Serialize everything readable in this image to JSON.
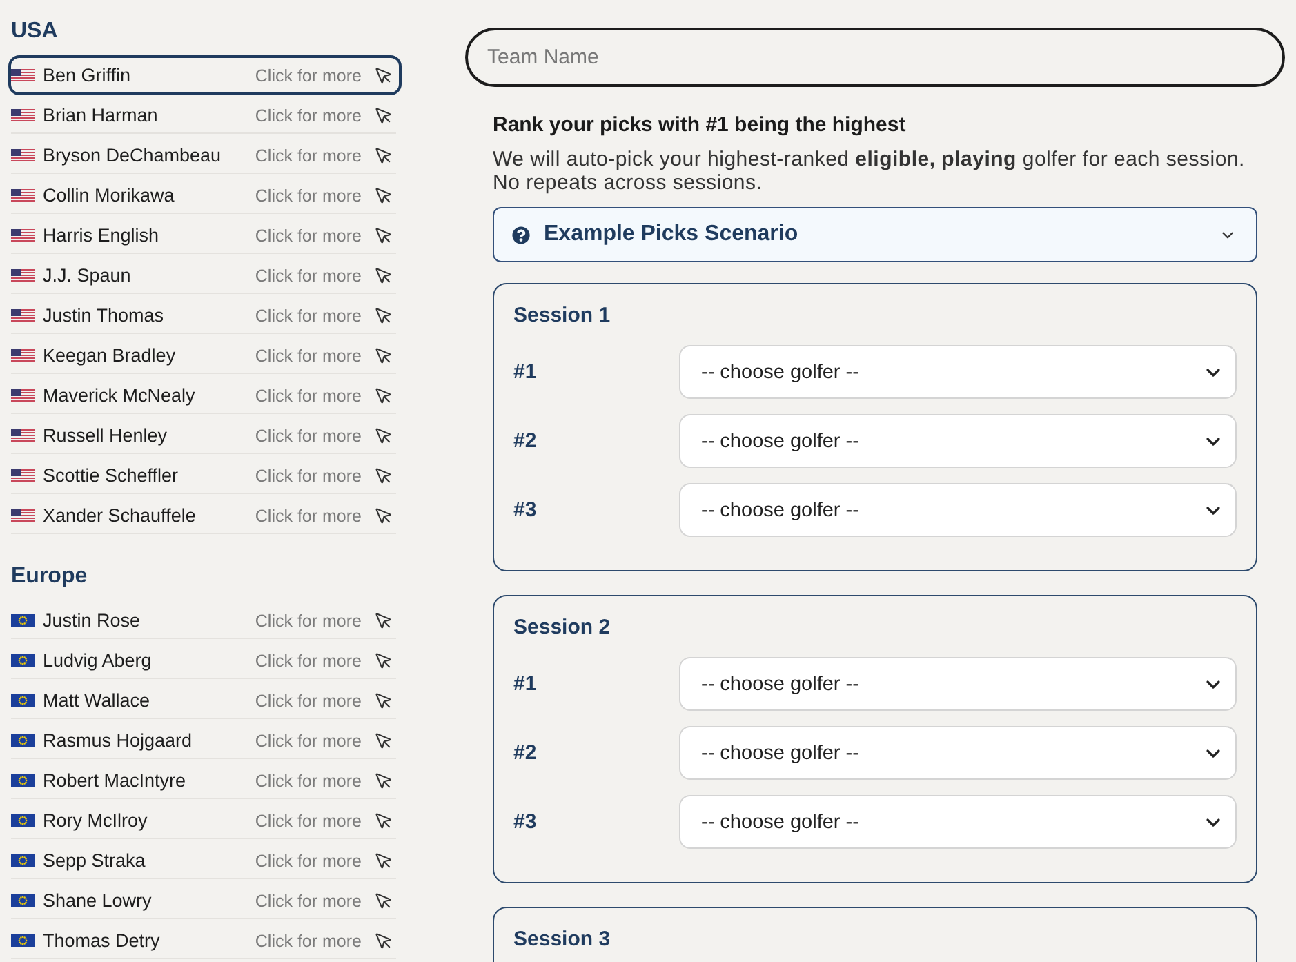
{
  "sidebar": {
    "groups": [
      {
        "title": "USA",
        "kind": "us",
        "players": [
          {
            "name": "Ben Griffin",
            "hint": "Click for more",
            "selected": true
          },
          {
            "name": "Brian Harman",
            "hint": "Click for more",
            "selected": false
          },
          {
            "name": "Bryson DeChambeau",
            "hint": "Click for more",
            "selected": false
          },
          {
            "name": "Collin Morikawa",
            "hint": "Click for more",
            "selected": false
          },
          {
            "name": "Harris English",
            "hint": "Click for more",
            "selected": false
          },
          {
            "name": "J.J. Spaun",
            "hint": "Click for more",
            "selected": false
          },
          {
            "name": "Justin Thomas",
            "hint": "Click for more",
            "selected": false
          },
          {
            "name": "Keegan Bradley",
            "hint": "Click for more",
            "selected": false
          },
          {
            "name": "Maverick McNealy",
            "hint": "Click for more",
            "selected": false
          },
          {
            "name": "Russell Henley",
            "hint": "Click for more",
            "selected": false
          },
          {
            "name": "Scottie Scheffler",
            "hint": "Click for more",
            "selected": false
          },
          {
            "name": "Xander Schauffele",
            "hint": "Click for more",
            "selected": false
          }
        ]
      },
      {
        "title": "Europe",
        "kind": "eu",
        "players": [
          {
            "name": "Justin Rose",
            "hint": "Click for more",
            "selected": false
          },
          {
            "name": "Ludvig Aberg",
            "hint": "Click for more",
            "selected": false
          },
          {
            "name": "Matt Wallace",
            "hint": "Click for more",
            "selected": false
          },
          {
            "name": "Rasmus Hojgaard",
            "hint": "Click for more",
            "selected": false
          },
          {
            "name": "Robert MacIntyre",
            "hint": "Click for more",
            "selected": false
          },
          {
            "name": "Rory McIlroy",
            "hint": "Click for more",
            "selected": false
          },
          {
            "name": "Sepp Straka",
            "hint": "Click for more",
            "selected": false
          },
          {
            "name": "Shane Lowry",
            "hint": "Click for more",
            "selected": false
          },
          {
            "name": "Thomas Detry",
            "hint": "Click for more",
            "selected": false
          }
        ]
      }
    ]
  },
  "team_name": {
    "placeholder": "Team Name"
  },
  "instructions": {
    "heading": "Rank your picks with #1 being the highest",
    "text": "We will auto-pick your highest-ranked **eligible, playing** golfer for each session. No repeats across sessions."
  },
  "accordion": {
    "title": "Example Picks Scenario",
    "expanded": false
  },
  "sessions": [
    {
      "title": "Session 1",
      "picks": [
        {
          "rank": "#1",
          "value": "-- choose golfer --"
        },
        {
          "rank": "#2",
          "value": "-- choose golfer --"
        },
        {
          "rank": "#3",
          "value": "-- choose golfer --"
        }
      ]
    },
    {
      "title": "Session 2",
      "picks": [
        {
          "rank": "#1",
          "value": "-- choose golfer --"
        },
        {
          "rank": "#2",
          "value": "-- choose golfer --"
        },
        {
          "rank": "#3",
          "value": "-- choose golfer --"
        }
      ]
    },
    {
      "title": "Session 3"
    }
  ]
}
